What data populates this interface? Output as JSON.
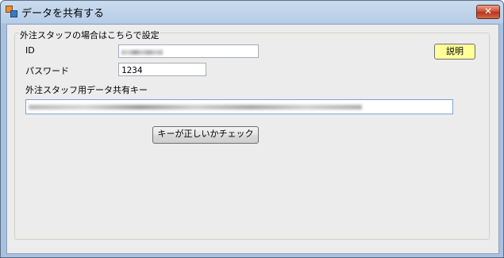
{
  "window": {
    "title": "データを共有する",
    "close_glyph": "✕"
  },
  "group": {
    "title": "外注スタッフの場合はこちらで設定"
  },
  "form": {
    "id_label": "ID",
    "password_label": "パスワード",
    "password_value": "1234",
    "key_label": "外注スタッフ用データ共有キー"
  },
  "buttons": {
    "help_label": "説明",
    "check_label": "キーが正しいかチェック"
  },
  "colors": {
    "help_button_bg": "#ffff99",
    "close_button_bg": "#c84a2e"
  }
}
